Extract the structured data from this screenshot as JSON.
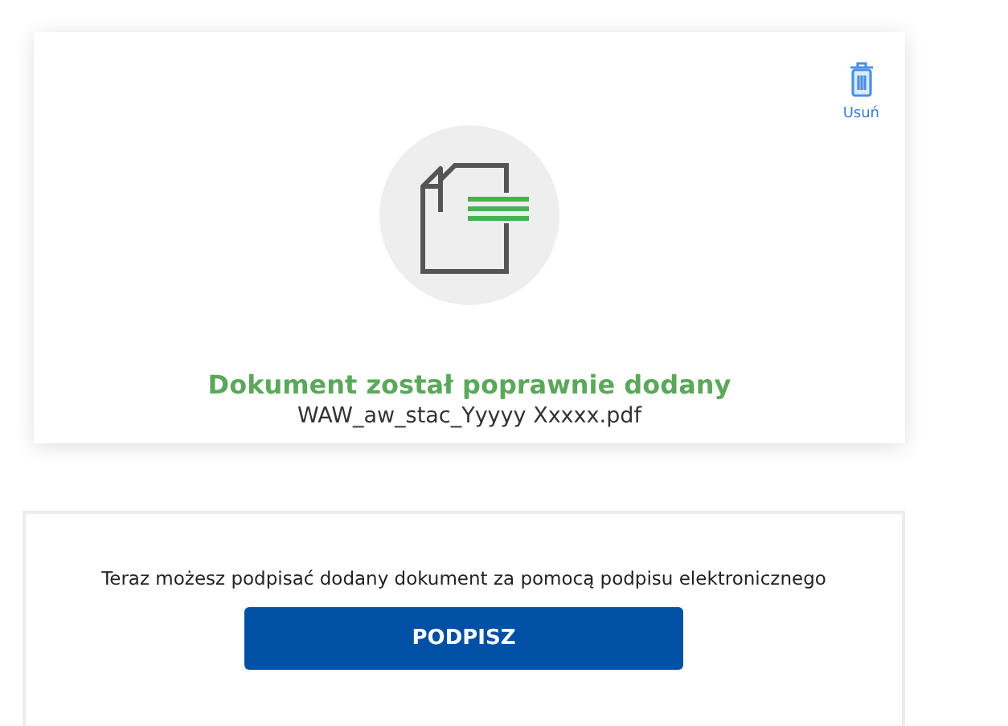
{
  "upload_card": {
    "delete_label": "Usuń",
    "status": "Dokument został poprawnie dodany",
    "file_name": "WAW_aw_stac_Yyyyy Xxxxx.pdf"
  },
  "sign_panel": {
    "message": "Teraz możesz podpisać dodany dokument za pomocą podpisu elektronicznego",
    "button": "PODPISZ"
  }
}
